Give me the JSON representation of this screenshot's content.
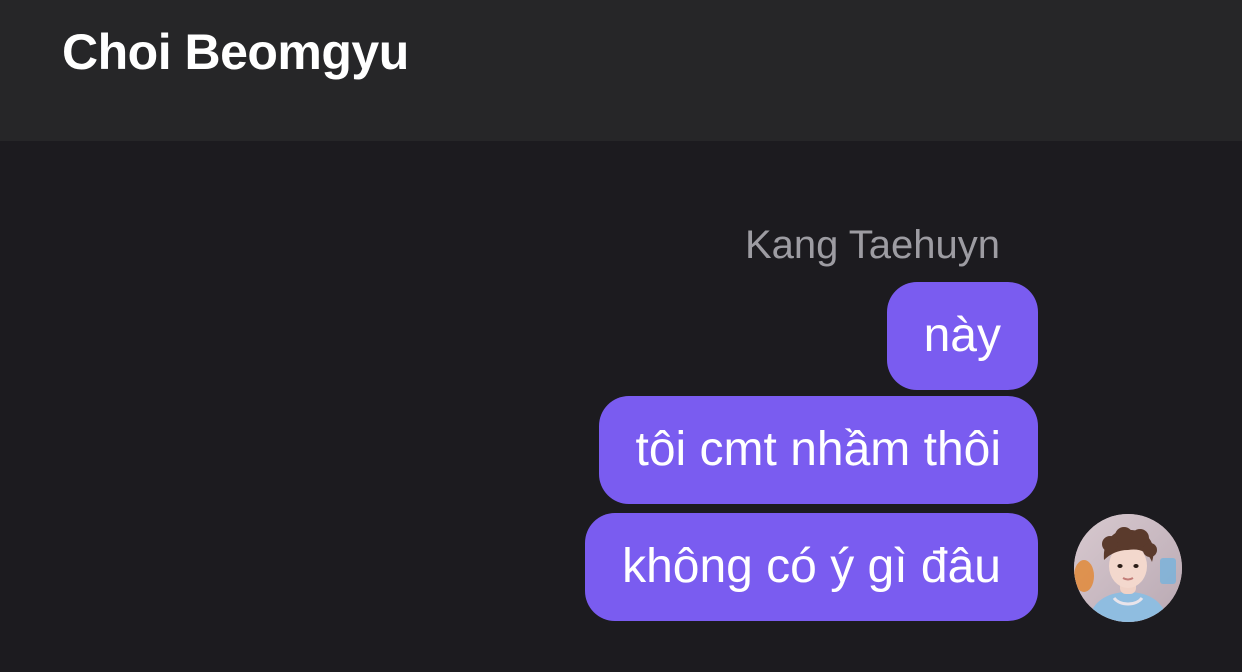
{
  "header": {
    "title": "Choi Beomgyu"
  },
  "conversation": {
    "sender_name": "Kang Taehuyn",
    "messages": [
      {
        "text": "này"
      },
      {
        "text": "tôi cmt nhầm thôi"
      },
      {
        "text": "không có ý gì đâu"
      }
    ],
    "bubble_color": "#7a5cf0",
    "avatar_icon": "profile-photo"
  }
}
